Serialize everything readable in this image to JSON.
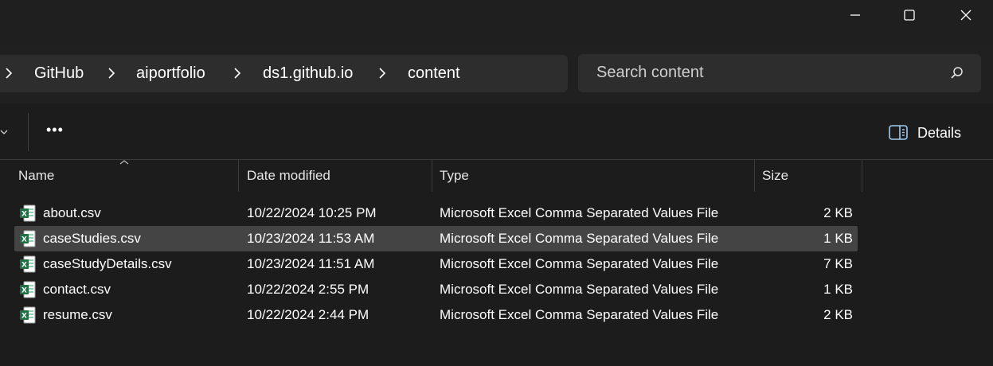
{
  "window": {
    "minimize_icon": "minimize-icon",
    "maximize_icon": "maximize-icon",
    "close_icon": "close-icon"
  },
  "breadcrumb": [
    "GitHub",
    "aiportfolio",
    "ds1.github.io",
    "content"
  ],
  "search": {
    "placeholder": "Search content"
  },
  "toolbar": {
    "more_label": "•••",
    "details_label": "Details"
  },
  "columns": {
    "name": "Name",
    "date": "Date modified",
    "type": "Type",
    "size": "Size"
  },
  "files": [
    {
      "name": "about.csv",
      "date": "10/22/2024 10:25 PM",
      "type": "Microsoft Excel Comma Separated Values File",
      "size": "2 KB",
      "selected": false
    },
    {
      "name": "caseStudies.csv",
      "date": "10/23/2024 11:53 AM",
      "type": "Microsoft Excel Comma Separated Values File",
      "size": "1 KB",
      "selected": true
    },
    {
      "name": "caseStudyDetails.csv",
      "date": "10/23/2024 11:51 AM",
      "type": "Microsoft Excel Comma Separated Values File",
      "size": "7 KB",
      "selected": false
    },
    {
      "name": "contact.csv",
      "date": "10/22/2024 2:55 PM",
      "type": "Microsoft Excel Comma Separated Values File",
      "size": "1 KB",
      "selected": false
    },
    {
      "name": "resume.csv",
      "date": "10/22/2024 2:44 PM",
      "type": "Microsoft Excel Comma Separated Values File",
      "size": "2 KB",
      "selected": false
    }
  ],
  "colors": {
    "accent_excel": "#1d7044",
    "selection": "#444444"
  }
}
